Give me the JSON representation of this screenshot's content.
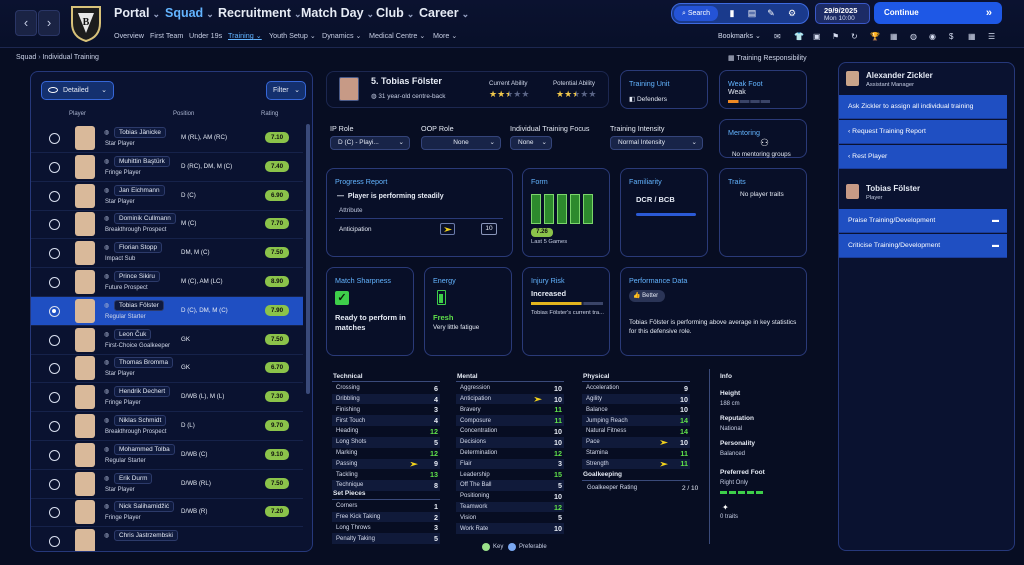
{
  "topbar": {
    "main_nav": [
      "Portal",
      "Squad",
      "Recruitment",
      "Match Day",
      "Club",
      "Career"
    ],
    "sub_nav": [
      "Overview",
      "First Team",
      "Under 19s",
      "Training",
      "Youth Setup",
      "Dynamics",
      "Medical Centre",
      "More"
    ],
    "search_label": "Search",
    "date": "29/9/2025",
    "day_time": "Mon 10:00",
    "continue_label": "Continue",
    "bookmarks_label": "Bookmarks"
  },
  "breadcrumb": {
    "root": "Squad",
    "current": "Individual Training"
  },
  "training_responsibility": "Training Responsibility",
  "left": {
    "view_label": "Detailed",
    "filter_label": "Filter",
    "col_player": "Player",
    "col_position": "Position",
    "col_rating": "Rating",
    "players": [
      {
        "name": "Tobias Jänicke",
        "role": "Star Player",
        "position": "M (RL), AM (RC)",
        "rating": "7.10"
      },
      {
        "name": "Muhittin Baştürk",
        "role": "Fringe Player",
        "position": "D (RC), DM, M (C)",
        "rating": "7.40"
      },
      {
        "name": "Jan Eichmann",
        "role": "Star Player",
        "position": "D (C)",
        "rating": "6.90"
      },
      {
        "name": "Dominik Cullmann",
        "role": "Breakthrough Prospect",
        "position": "M (C)",
        "rating": "7.70"
      },
      {
        "name": "Florian Stopp",
        "role": "Impact Sub",
        "position": "DM, M (C)",
        "rating": "7.50"
      },
      {
        "name": "Prince Sikiru",
        "role": "Future Prospect",
        "position": "M (C), AM (LC)",
        "rating": "8.90"
      },
      {
        "name": "Tobias Fölster",
        "role": "Regular Starter",
        "position": "D (C), DM, M (C)",
        "rating": "7.90"
      },
      {
        "name": "Leon Čuk",
        "role": "First-Choice Goalkeeper",
        "position": "GK",
        "rating": "7.50"
      },
      {
        "name": "Thomas Bromma",
        "role": "Star Player",
        "position": "GK",
        "rating": "6.70"
      },
      {
        "name": "Hendrik Dechert",
        "role": "Fringe Player",
        "position": "D/WB (L), M (L)",
        "rating": "7.30"
      },
      {
        "name": "Niklas Schmidt",
        "role": "Breakthrough Prospect",
        "position": "D (L)",
        "rating": "9.70"
      },
      {
        "name": "Mohammed Tolba",
        "role": "Regular Starter",
        "position": "D/WB (C)",
        "rating": "9.10"
      },
      {
        "name": "Erik Durm",
        "role": "Star Player",
        "position": "D/WB (RL)",
        "rating": "7.50"
      },
      {
        "name": "Nick Salihamidžić",
        "role": "Fringe Player",
        "position": "D/WB (R)",
        "rating": "7.20"
      },
      {
        "name": "Chris Jastrzembski",
        "role": "",
        "position": "",
        "rating": ""
      }
    ]
  },
  "profile": {
    "name": "5. Tobias Fölster",
    "desc": "31 year-old centre-back",
    "current_ability_label": "Current Ability",
    "potential_ability_label": "Potential Ability",
    "current_stars": 2.5,
    "potential_stars": 2.5
  },
  "training_unit": {
    "title": "Training Unit",
    "value": "Defenders"
  },
  "weak_foot": {
    "title": "Weak Foot",
    "value": "Weak"
  },
  "mentoring": {
    "title": "Mentoring",
    "value": "No mentoring groups"
  },
  "roles": {
    "ip_label": "IP Role",
    "ip_value": "D (C) - Playi...",
    "oop_label": "OOP Role",
    "oop_value": "None",
    "focus_label": "Individual Training Focus",
    "focus_value": "None",
    "intensity_label": "Training Intensity",
    "intensity_value": "Normal Intensity"
  },
  "progress": {
    "title": "Progress Report",
    "headline": "Player is performing steadily",
    "attr_label": "Attribute",
    "attr_name": "Anticipation",
    "attr_value": "10"
  },
  "form": {
    "title": "Form",
    "rating": "7.26",
    "caption": "Last 5 Games"
  },
  "familiarity": {
    "title": "Familiarity",
    "value": "DCR / BCB"
  },
  "traits": {
    "title": "Traits",
    "value": "No player traits"
  },
  "sharpness": {
    "title": "Match Sharpness",
    "value": "Ready to perform in matches"
  },
  "energy": {
    "title": "Energy",
    "value": "Fresh",
    "detail": "Very little fatigue"
  },
  "injury": {
    "title": "Injury Risk",
    "value": "Increased",
    "detail": "Tobias Fölster's current tra..."
  },
  "performance": {
    "title": "Performance Data",
    "badge": "Better",
    "text": "Tobias Fölster is performing above average in key statistics for this defensive role."
  },
  "attributes": {
    "technical_title": "Technical",
    "technical": [
      {
        "name": "Crossing",
        "value": "6",
        "key": false
      },
      {
        "name": "Dribbling",
        "value": "4",
        "key": false
      },
      {
        "name": "Finishing",
        "value": "3",
        "key": false
      },
      {
        "name": "First Touch",
        "value": "4",
        "key": false
      },
      {
        "name": "Heading",
        "value": "12",
        "key": false
      },
      {
        "name": "Long Shots",
        "value": "5",
        "key": false
      },
      {
        "name": "Marking",
        "value": "12",
        "key": false
      },
      {
        "name": "Passing",
        "value": "9",
        "key": true
      },
      {
        "name": "Tackling",
        "value": "13",
        "key": false
      },
      {
        "name": "Technique",
        "value": "8",
        "key": false
      }
    ],
    "setpieces_title": "Set Pieces",
    "setpieces": [
      {
        "name": "Corners",
        "value": "1"
      },
      {
        "name": "Free Kick Taking",
        "value": "2"
      },
      {
        "name": "Long Throws",
        "value": "3"
      },
      {
        "name": "Penalty Taking",
        "value": "5"
      }
    ],
    "mental_title": "Mental",
    "mental": [
      {
        "name": "Aggression",
        "value": "10",
        "key": false
      },
      {
        "name": "Anticipation",
        "value": "10",
        "key": true
      },
      {
        "name": "Bravery",
        "value": "11",
        "key": false
      },
      {
        "name": "Composure",
        "value": "11",
        "key": false
      },
      {
        "name": "Concentration",
        "value": "10",
        "key": false
      },
      {
        "name": "Decisions",
        "value": "10",
        "key": false
      },
      {
        "name": "Determination",
        "value": "12",
        "key": false
      },
      {
        "name": "Flair",
        "value": "3",
        "key": false
      },
      {
        "name": "Leadership",
        "value": "15",
        "key": false
      },
      {
        "name": "Off The Ball",
        "value": "5",
        "key": false
      },
      {
        "name": "Positioning",
        "value": "10",
        "key": false
      },
      {
        "name": "Teamwork",
        "value": "12",
        "key": false
      },
      {
        "name": "Vision",
        "value": "5",
        "key": false
      },
      {
        "name": "Work Rate",
        "value": "10",
        "key": false
      }
    ],
    "physical_title": "Physical",
    "physical": [
      {
        "name": "Acceleration",
        "value": "9",
        "key": false
      },
      {
        "name": "Agility",
        "value": "10",
        "key": false
      },
      {
        "name": "Balance",
        "value": "10",
        "key": false
      },
      {
        "name": "Jumping Reach",
        "value": "14",
        "key": false
      },
      {
        "name": "Natural Fitness",
        "value": "14",
        "key": false
      },
      {
        "name": "Pace",
        "value": "10",
        "key": true
      },
      {
        "name": "Stamina",
        "value": "11",
        "key": false
      },
      {
        "name": "Strength",
        "value": "11",
        "key": true
      }
    ],
    "gk_title": "Goalkeeping",
    "gk_label": "Goalkeeper Rating",
    "gk_value": "2 / 10",
    "key_label": "Key",
    "preferable_label": "Preferable"
  },
  "info": {
    "title": "Info",
    "height_label": "Height",
    "height_value": "188 cm",
    "reputation_label": "Reputation",
    "reputation_value": "National",
    "personality_label": "Personality",
    "personality_value": "Balanced",
    "foot_label": "Preferred Foot",
    "foot_value": "Right Only",
    "traits_count": "0 traits"
  },
  "right": {
    "staff_name": "Alexander Zickler",
    "staff_role": "Assistant Manager",
    "assign_text": "Ask Zickler to assign all individual training",
    "request_report": "Request Training Report",
    "rest_player": "Rest Player",
    "player_name": "Tobias Fölster",
    "player_role": "Player",
    "praise": "Praise Training/Development",
    "criticise": "Criticise Training/Development"
  },
  "colors": {
    "accent": "#63b4ff",
    "selected_row": "#1f4fc2",
    "rating_pill": "#8bc34a",
    "good": "#5fe14a",
    "key_arrow": "#f2d21b"
  }
}
